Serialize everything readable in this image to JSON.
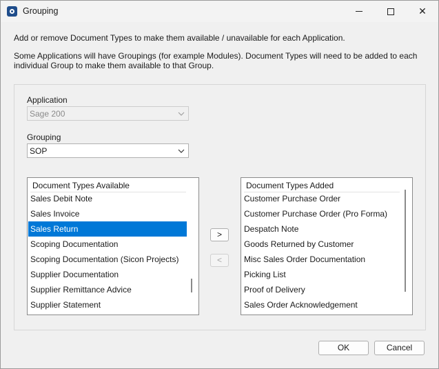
{
  "window": {
    "title": "Grouping"
  },
  "intro": {
    "line1": "Add or remove Document Types to make them available / unavailable for each Application.",
    "line2": "Some Applications will have Groupings (for example Modules). Document Types will need to be added to each individual Group to make them available to that Group."
  },
  "application": {
    "label": "Application",
    "value": "Sage 200"
  },
  "grouping": {
    "label": "Grouping",
    "value": "SOP"
  },
  "available": {
    "header": "Document Types Available",
    "items": [
      "Sales Debit Note",
      "Sales Invoice",
      "Sales Return",
      "Scoping Documentation",
      "Scoping Documentation (Sicon Projects)",
      "Supplier Documentation",
      "Supplier Remittance Advice",
      "Supplier Statement"
    ],
    "selected_index": 2
  },
  "added": {
    "header": "Document Types Added",
    "items": [
      "Customer Purchase Order",
      "Customer Purchase Order (Pro Forma)",
      "Despatch Note",
      "Goods Returned by Customer",
      "Misc Sales Order Documentation",
      "Picking List",
      "Proof of Delivery",
      "Sales Order Acknowledgement"
    ]
  },
  "buttons": {
    "add": ">",
    "remove": "<",
    "ok": "OK",
    "cancel": "Cancel"
  },
  "icons": {
    "app": "app-gear-icon",
    "minimize": "minimize-icon",
    "maximize": "maximize-icon",
    "close": "close-icon",
    "dropdown": "chevron-down-icon"
  }
}
